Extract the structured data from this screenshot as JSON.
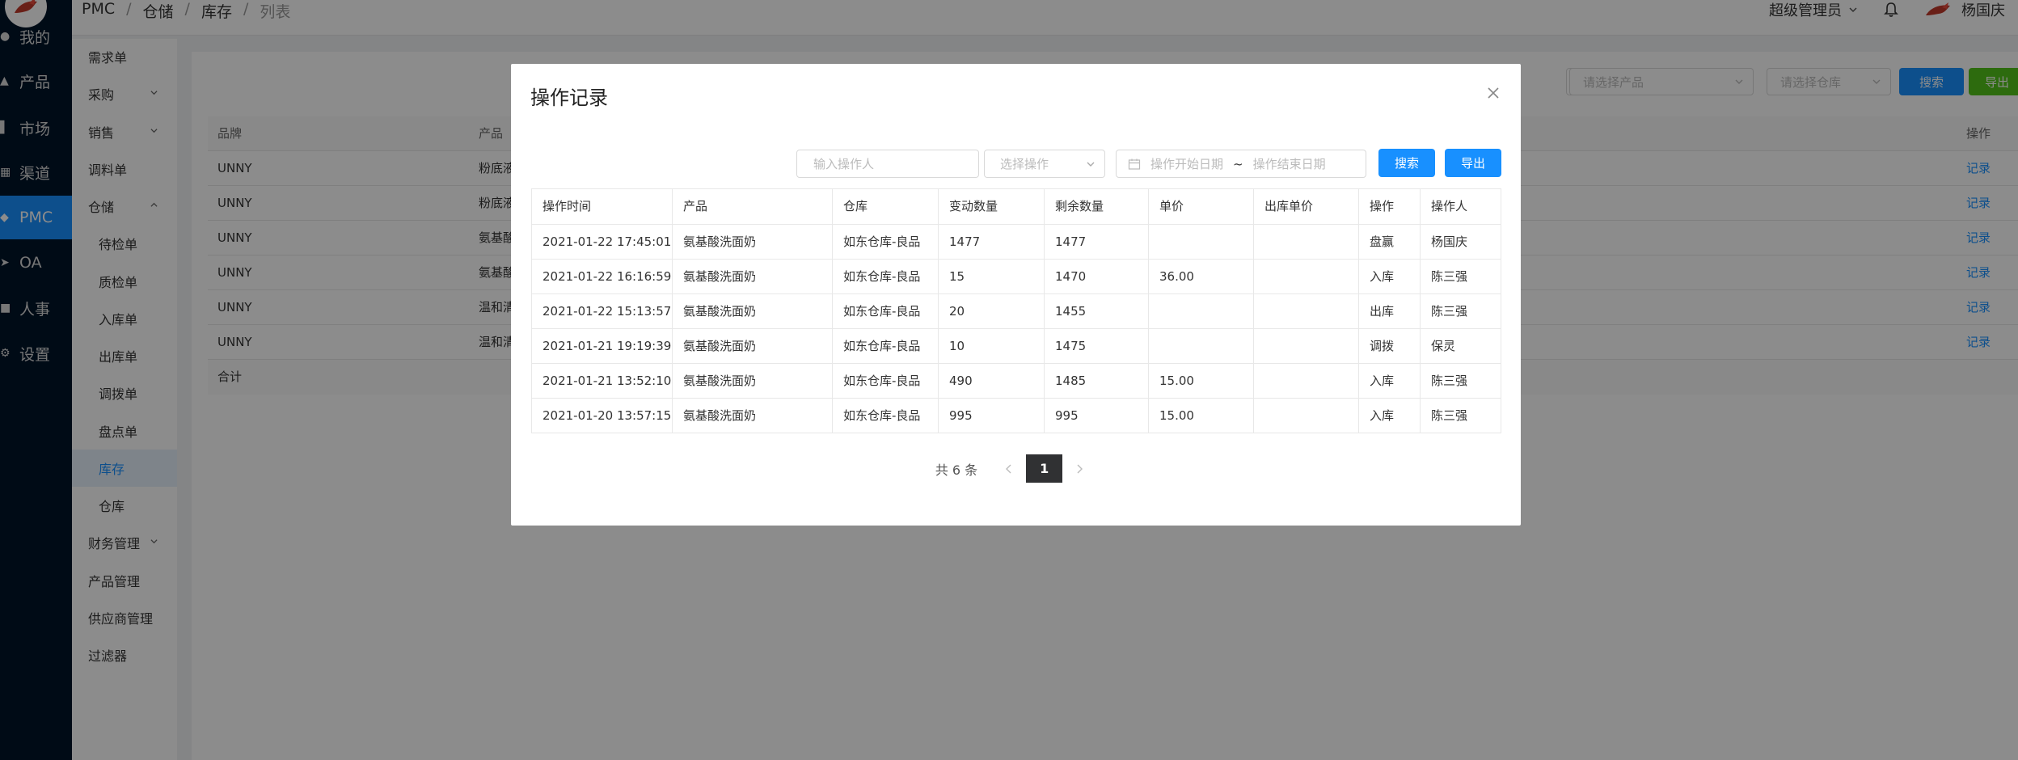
{
  "rail": {
    "items": [
      {
        "label": "我的",
        "icon": "user-icon"
      },
      {
        "label": "产品",
        "icon": "box-icon"
      },
      {
        "label": "市场",
        "icon": "bar-chart-icon"
      },
      {
        "label": "渠道",
        "icon": "grid-icon"
      },
      {
        "label": "PMC",
        "icon": "layers-icon",
        "active": true
      },
      {
        "label": "OA",
        "icon": "send-icon"
      },
      {
        "label": "人事",
        "icon": "message-icon"
      },
      {
        "label": "设置",
        "icon": "gear-icon"
      }
    ]
  },
  "sidebar": {
    "items": [
      {
        "label": "需求单"
      },
      {
        "label": "采购",
        "expand": "down"
      },
      {
        "label": "销售",
        "expand": "down"
      },
      {
        "label": "调料单"
      },
      {
        "label": "仓储",
        "expand": "up"
      },
      {
        "label": "待检单",
        "sub": true
      },
      {
        "label": "质检单",
        "sub": true
      },
      {
        "label": "入库单",
        "sub": true
      },
      {
        "label": "出库单",
        "sub": true
      },
      {
        "label": "调拨单",
        "sub": true
      },
      {
        "label": "盘点单",
        "sub": true
      },
      {
        "label": "库存",
        "sub": true,
        "active": true
      },
      {
        "label": "仓库",
        "sub": true
      },
      {
        "label": "财务管理",
        "expand": "down"
      },
      {
        "label": "产品管理"
      },
      {
        "label": "供应商管理"
      },
      {
        "label": "过滤器"
      }
    ]
  },
  "header": {
    "breadcrumb": [
      "PMC",
      "仓储",
      "库存",
      "列表"
    ],
    "role": "超级管理员",
    "username": "杨国庆"
  },
  "filters": {
    "product_placeholder": "请选择产品",
    "warehouse_placeholder": "请选择仓库",
    "search_label": "搜索",
    "export_label": "导出"
  },
  "bg_table": {
    "headers": {
      "brand": "品牌",
      "product": "产品",
      "action": "操作"
    },
    "rows": [
      {
        "brand": "UNNY",
        "product": "粉底液",
        "action": "记录"
      },
      {
        "brand": "UNNY",
        "product": "粉底液",
        "action": "记录"
      },
      {
        "brand": "UNNY",
        "product": "氨基酸",
        "action": "记录"
      },
      {
        "brand": "UNNY",
        "product": "氨基酸",
        "action": "记录"
      },
      {
        "brand": "UNNY",
        "product": "温和清",
        "action": "记录"
      },
      {
        "brand": "UNNY",
        "product": "温和清",
        "action": "记录"
      }
    ],
    "total_label": "合计"
  },
  "modal": {
    "title": "操作记录",
    "operator_placeholder": "输入操作人",
    "operation_placeholder": "选择操作",
    "start_date_placeholder": "操作开始日期",
    "range_separator": "~",
    "end_date_placeholder": "操作结束日期",
    "search_label": "搜索",
    "export_label": "导出",
    "columns": [
      "操作时间",
      "产品",
      "仓库",
      "变动数量",
      "剩余数量",
      "单价",
      "出库单价",
      "操作",
      "操作人"
    ],
    "rows": [
      [
        "2021-01-22 17:45:01",
        "氨基酸洗面奶",
        "如东仓库-良品",
        "1477",
        "1477",
        "",
        "",
        "盘赢",
        "杨国庆"
      ],
      [
        "2021-01-22 16:16:59",
        "氨基酸洗面奶",
        "如东仓库-良品",
        "15",
        "1470",
        "36.00",
        "",
        "入库",
        "陈三强"
      ],
      [
        "2021-01-22 15:13:57",
        "氨基酸洗面奶",
        "如东仓库-良品",
        "20",
        "1455",
        "",
        "",
        "出库",
        "陈三强"
      ],
      [
        "2021-01-21 19:19:39",
        "氨基酸洗面奶",
        "如东仓库-良品",
        "10",
        "1475",
        "",
        "",
        "调拨",
        "保灵"
      ],
      [
        "2021-01-21 13:52:10",
        "氨基酸洗面奶",
        "如东仓库-良品",
        "490",
        "1485",
        "15.00",
        "",
        "入库",
        "陈三强"
      ],
      [
        "2021-01-20 13:57:15",
        "氨基酸洗面奶",
        "如东仓库-良品",
        "995",
        "995",
        "15.00",
        "",
        "入库",
        "陈三强"
      ]
    ],
    "pagination": {
      "total_text": "共 6 条",
      "current_page": "1"
    }
  },
  "colors": {
    "primary": "#1890ff",
    "success": "#52c41a",
    "rail_bg": "#001529",
    "mask": "rgba(0,0,0,0.45)"
  }
}
